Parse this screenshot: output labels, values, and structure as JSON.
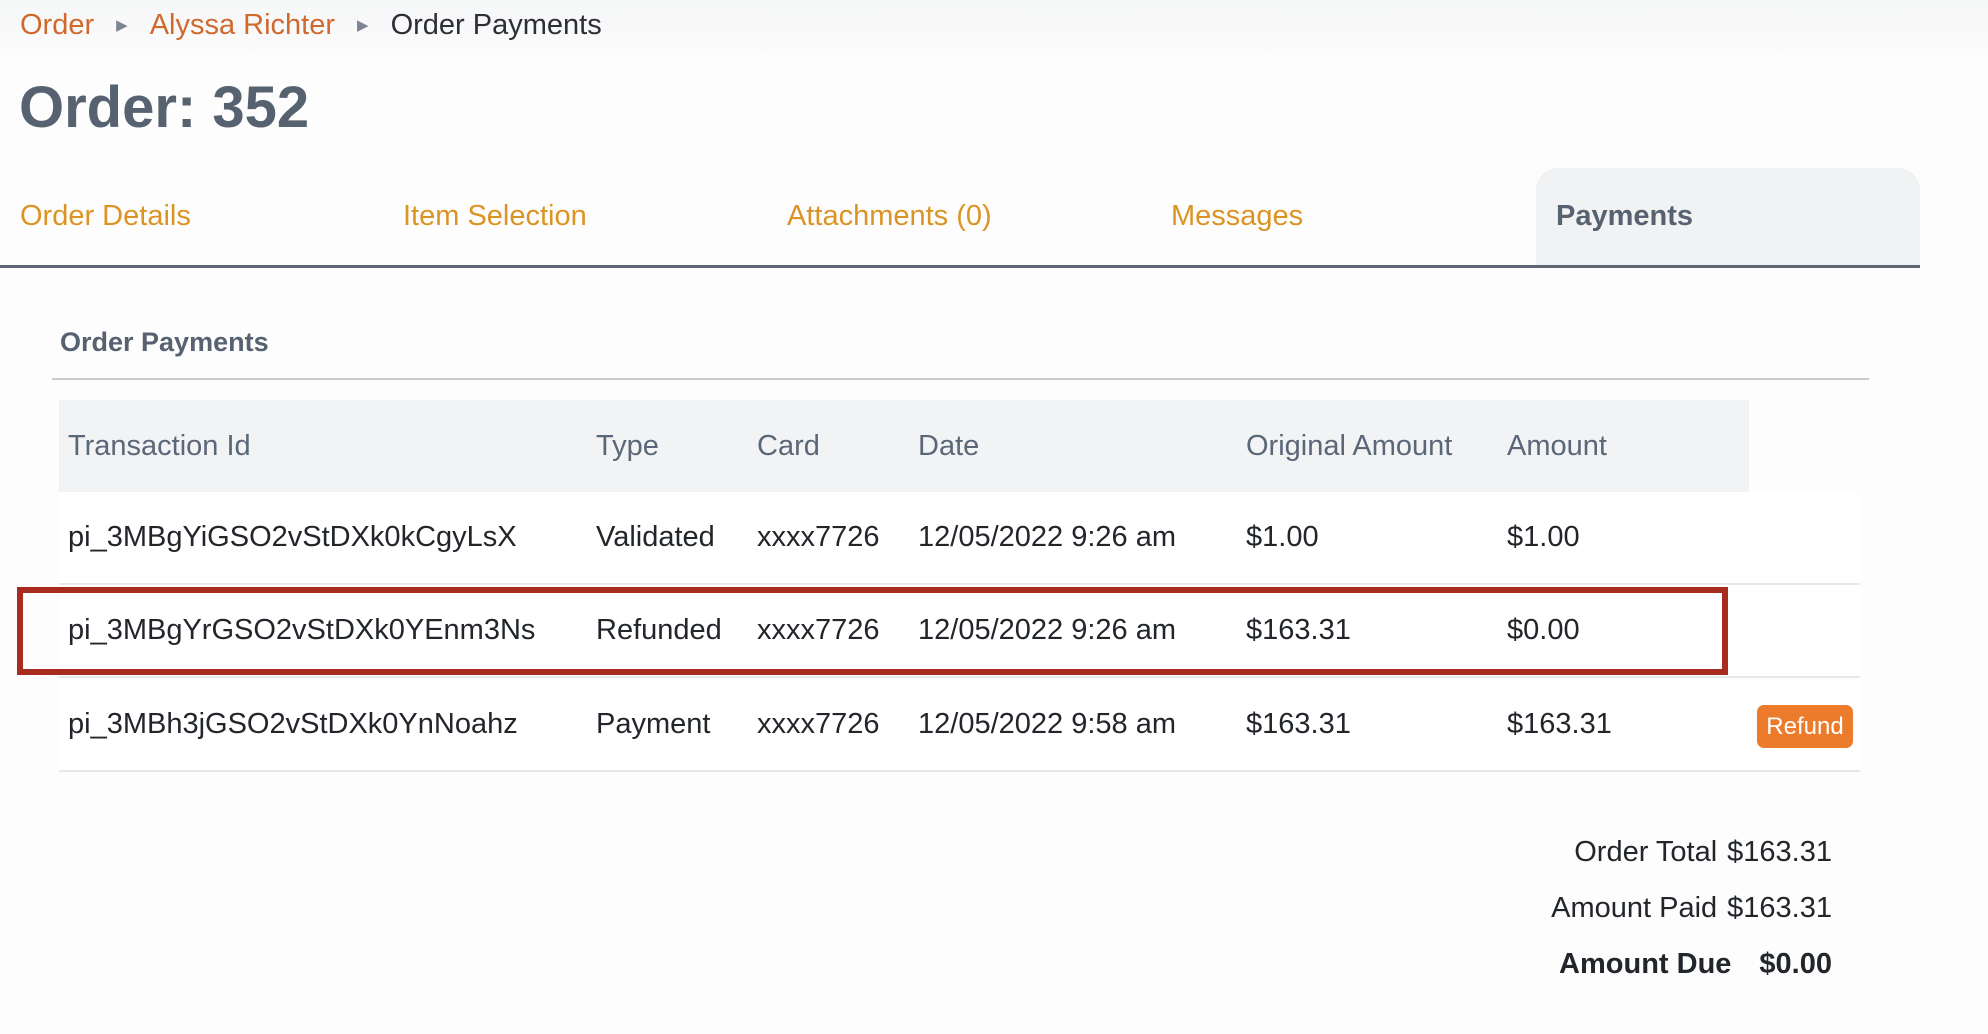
{
  "breadcrumb": {
    "items": [
      "Order",
      "Alyssa Richter"
    ],
    "current": "Order Payments"
  },
  "page_title": "Order: 352",
  "tabs": [
    {
      "label": "Order Details"
    },
    {
      "label": "Item Selection"
    },
    {
      "label": "Attachments (0)"
    },
    {
      "label": "Messages"
    },
    {
      "label": "Payments",
      "active": true
    }
  ],
  "section": {
    "title": "Order Payments"
  },
  "table": {
    "headers": [
      "Transaction Id",
      "Type",
      "Card",
      "Date",
      "Original Amount",
      "Amount"
    ],
    "rows": [
      {
        "transaction_id": "pi_3MBgYiGSO2vStDXk0kCgyLsX",
        "type": "Validated",
        "card": "xxxx7726",
        "date": "12/05/2022 9:26 am",
        "original_amount": "$1.00",
        "amount": "$1.00"
      },
      {
        "transaction_id": "pi_3MBgYrGSO2vStDXk0YEnm3Ns",
        "type": "Refunded",
        "card": "xxxx7726",
        "date": "12/05/2022 9:26 am",
        "original_amount": "$163.31",
        "amount": "$0.00",
        "highlighted": true
      },
      {
        "transaction_id": "pi_3MBh3jGSO2vStDXk0YnNoahz",
        "type": "Payment",
        "card": "xxxx7726",
        "date": "12/05/2022 9:58 am",
        "original_amount": "$163.31",
        "amount": "$163.31",
        "action_label": "Refund"
      }
    ]
  },
  "summary": {
    "order_total": {
      "label": "Order Total",
      "value": "$163.31"
    },
    "amount_paid": {
      "label": "Amount Paid",
      "value": "$163.31"
    },
    "amount_due": {
      "label": "Amount Due",
      "value": "$0.00"
    }
  },
  "colors": {
    "link": "#d0692e",
    "tab_link": "#db9424",
    "title": "#56626f",
    "refund_button": "#ec7c2c",
    "highlight_border": "#a72b1e"
  }
}
